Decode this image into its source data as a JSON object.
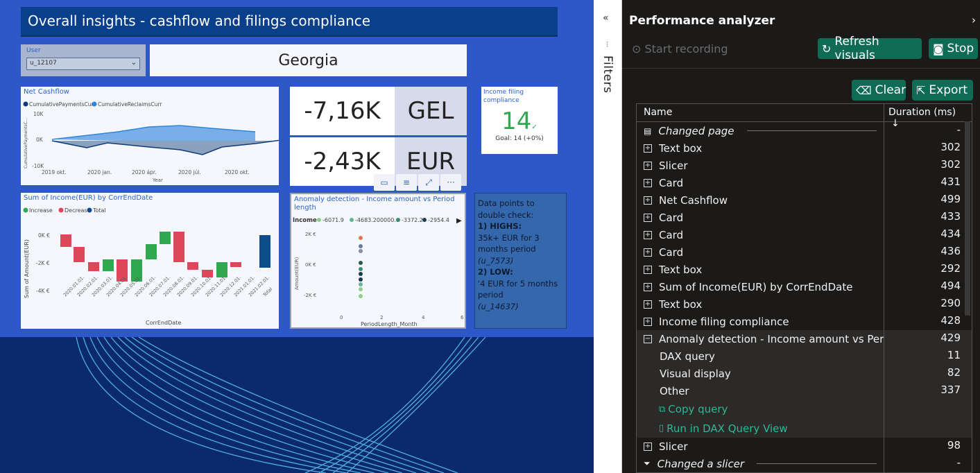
{
  "report": {
    "title": "Overall insights - cashflow and filings compliance",
    "slicer": {
      "label": "User",
      "value": "u_12107"
    },
    "country": "Georgia",
    "net_cashflow": {
      "title": "Net Cashflow",
      "legend": [
        "CumulativePaymentsCurr",
        "CumulativeReclaimsCurr"
      ],
      "y_ticks": [
        "10K",
        "0K",
        "-10K"
      ],
      "x_ticks": [
        "2019 okt.",
        "2020 jan.",
        "2020 ápr.",
        "2020 júl.",
        "2020 okt."
      ],
      "ylabel": "CumulativePaymentsC...",
      "xlabel": "Year"
    },
    "card_gel": {
      "value": "-7,16K",
      "currency": "GEL"
    },
    "card_eur": {
      "value": "-2,43K",
      "currency": "EUR"
    },
    "income_filing": {
      "title": "Income filing compliance",
      "value": "14",
      "check": "✓",
      "goal": "Goal: 14 (+0%)"
    },
    "sum_income": {
      "title": "Sum of Income(EUR) by CorrEndDate",
      "legend": [
        "Increase",
        "Decrease",
        "Total"
      ],
      "y_ticks": [
        "0K €",
        "-2K €",
        "-4K €"
      ],
      "ylabel": "Sum of Amount(EUR)",
      "xlabel": "CorrEndDate",
      "x_ticks": [
        "2020.01.01.",
        "2020.02.01.",
        "2020.03.01.",
        "2020.04.01.",
        "2020.05.01.",
        "2020.06.01.",
        "2020.07.01.",
        "2020.08.01.",
        "2020.09.01.",
        "2020.10.01.",
        "2020.11.01.",
        "2020.12.01.",
        "2021.01.01.",
        "2021.02.01.",
        "Total"
      ]
    },
    "anomaly": {
      "title": "Anomaly detection - Income amount vs Period length",
      "legend_label": "Income",
      "legend": [
        "-6071.9",
        "-4683.200000...",
        "-3372.2",
        "-2954.4"
      ],
      "y_ticks": [
        "2K €",
        "0K €",
        "-2K €"
      ],
      "x_ticks": [
        "0",
        "2",
        "4",
        "6"
      ],
      "ylabel": "Amount(EUR)",
      "xlabel": "PeriodLength_Month"
    },
    "note": {
      "line1": "Data points to double check:",
      "highs": "1) HIGHS:",
      "high_text": "35k+ EUR for 3 months period",
      "high_user": "(u_7573)",
      "lows": "2) LOW:",
      "low_text": "'4 EUR for 5 months period",
      "low_user": "(u_14637)"
    }
  },
  "filters": {
    "label": "Filters",
    "collapse": "«"
  },
  "perf": {
    "title": "Performance analyzer",
    "start_recording": "Start recording",
    "refresh": "Refresh visuals",
    "stop": "Stop",
    "clear": "Clear",
    "export": "Export",
    "col_name": "Name",
    "col_duration": "Duration (ms)",
    "rows": [
      {
        "name": "Changed page",
        "duration": "-"
      },
      {
        "name": "Text box",
        "duration": "302"
      },
      {
        "name": "Slicer",
        "duration": "302"
      },
      {
        "name": "Card",
        "duration": "431"
      },
      {
        "name": "Net Cashflow",
        "duration": "499"
      },
      {
        "name": "Card",
        "duration": "433"
      },
      {
        "name": "Card",
        "duration": "434"
      },
      {
        "name": "Card",
        "duration": "436"
      },
      {
        "name": "Text box",
        "duration": "292"
      },
      {
        "name": "Sum of Income(EUR) by CorrEndDate",
        "duration": "494"
      },
      {
        "name": "Text box",
        "duration": "290"
      },
      {
        "name": "Income filing compliance",
        "duration": "428"
      },
      {
        "name": "Anomaly detection - Income amount vs Perio...",
        "duration": "429"
      },
      {
        "name": "DAX query",
        "duration": "11"
      },
      {
        "name": "Visual display",
        "duration": "82"
      },
      {
        "name": "Other",
        "duration": "337"
      },
      {
        "name": "Copy query",
        "duration": ""
      },
      {
        "name": "Run in DAX Query View",
        "duration": ""
      },
      {
        "name": "Slicer",
        "duration": "98"
      },
      {
        "name": "Changed a slicer",
        "duration": "-"
      }
    ]
  }
}
